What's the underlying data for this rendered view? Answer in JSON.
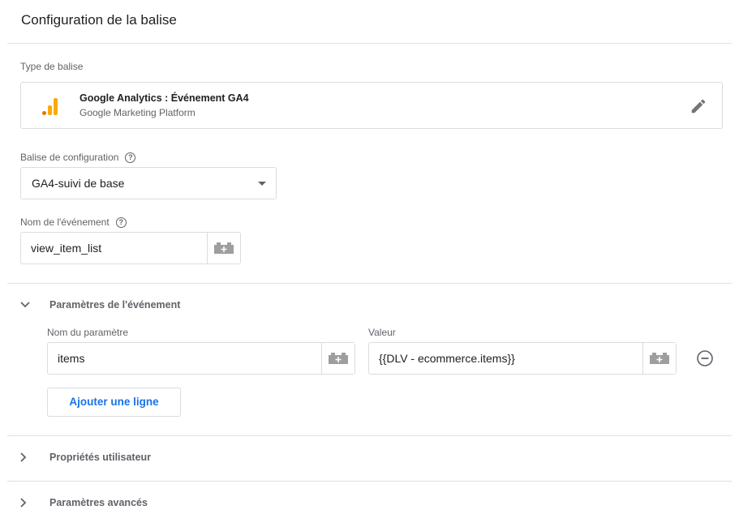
{
  "panel": {
    "title": "Configuration de la balise"
  },
  "tag_type": {
    "label": "Type de balise",
    "name": "Google Analytics : Événement GA4",
    "platform": "Google Marketing Platform",
    "logo_icon": "google-analytics-logo",
    "edit_icon": "pencil-icon"
  },
  "config_tag": {
    "label": "Balise de configuration",
    "value": "GA4-suivi de base",
    "help_icon": "help-circle-icon"
  },
  "event_name": {
    "label": "Nom de l'événement",
    "value": "view_item_list",
    "help_icon": "help-circle-icon",
    "variable_icon": "lego-brick-icon"
  },
  "event_params": {
    "header": "Paramètres de l'événement",
    "expanded": true,
    "col_name_label": "Nom du paramètre",
    "col_value_label": "Valeur",
    "rows": [
      {
        "name": "items",
        "value": "{{DLV - ecommerce.items}}"
      }
    ],
    "add_row_label": "Ajouter une ligne"
  },
  "user_properties": {
    "header": "Propriétés utilisateur",
    "expanded": false
  },
  "advanced": {
    "header": "Paramètres avancés",
    "expanded": false
  },
  "colors": {
    "accent_blue": "#1a73e8",
    "logo_orange": "#f9ab00",
    "logo_dark_orange": "#e37400",
    "border": "#dadce0",
    "secondary_text": "#5f6368"
  }
}
